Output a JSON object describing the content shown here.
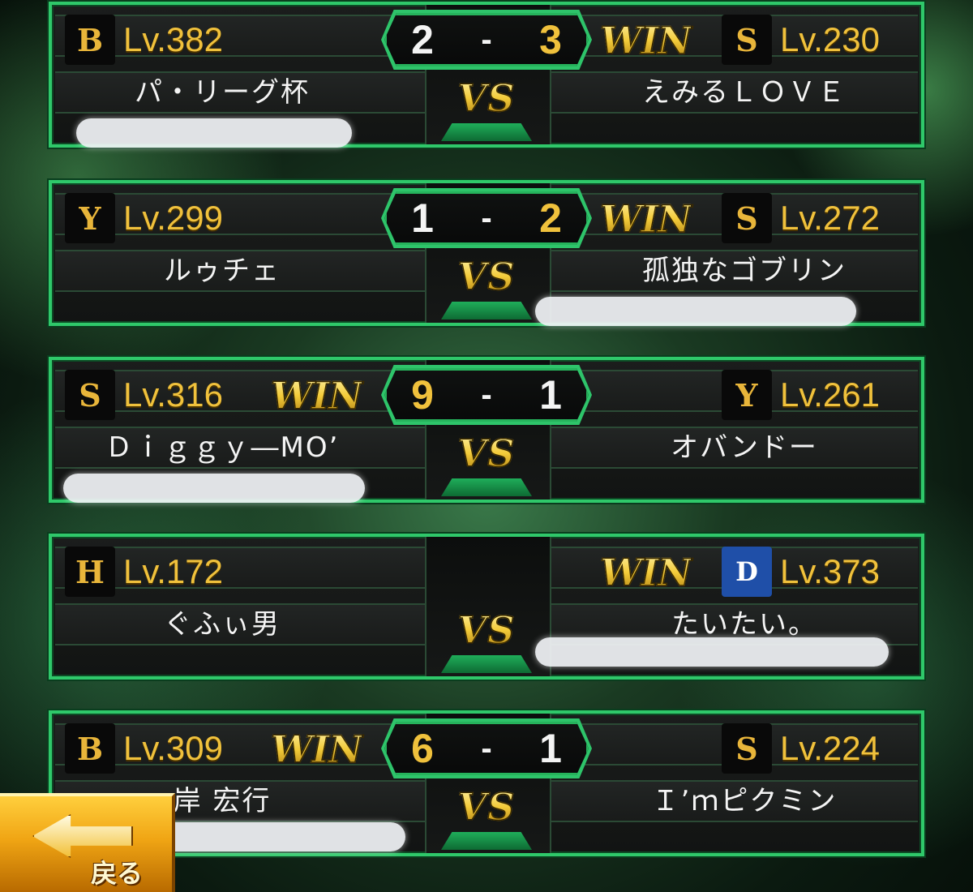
{
  "matches": [
    {
      "left": {
        "icon": "B",
        "icon_name": "buffaloes-logo-icon",
        "level": "Lv.382",
        "name": "パ・リーグ杯",
        "win": false
      },
      "right": {
        "icon": "S",
        "icon_name": "hawks-logo-icon",
        "level": "Lv.230",
        "name": "えみるＬＯＶＥ",
        "win": true
      },
      "score_left": "2",
      "score_right": "3"
    },
    {
      "left": {
        "icon": "Y",
        "icon_name": "giants-logo-icon",
        "level": "Lv.299",
        "name": "ルゥチェ",
        "win": false
      },
      "right": {
        "icon": "S",
        "icon_name": "hawks-logo-icon",
        "level": "Lv.272",
        "name": "孤独なゴブリン",
        "win": true
      },
      "score_left": "1",
      "score_right": "2"
    },
    {
      "left": {
        "icon": "S",
        "icon_name": "hawks-logo-icon",
        "level": "Lv.316",
        "name": "Ｄｉｇｇｙ―MO’",
        "win": true
      },
      "right": {
        "icon": "Y",
        "icon_name": "giants-logo-icon",
        "level": "Lv.261",
        "name": "オバンドー",
        "win": false
      },
      "score_left": "9",
      "score_right": "1"
    },
    {
      "left": {
        "icon": "H",
        "icon_name": "tigers-logo-icon",
        "level": "Lv.172",
        "name": "ぐふぃ男",
        "win": false
      },
      "right": {
        "icon": "D",
        "icon_name": "dragons-logo-icon",
        "level": "Lv.373",
        "name": "たいたい。",
        "win": true
      },
      "score_left": "",
      "score_right": ""
    },
    {
      "left": {
        "icon": "B",
        "icon_name": "buffaloes-logo-icon",
        "level": "Lv.309",
        "name": "岸 宏行",
        "win": true
      },
      "right": {
        "icon": "S",
        "icon_name": "hawks-logo-icon",
        "level": "Lv.224",
        "name": "Ｉ’ｍピクミン",
        "win": false
      },
      "score_left": "6",
      "score_right": "1"
    }
  ],
  "labels": {
    "win": "WIN",
    "vs": "VS",
    "dash": "-",
    "back": "戻る"
  },
  "colors": {
    "frame": "#2fc86a",
    "gold": "#f0c13c",
    "text": "#f4f4f4"
  }
}
